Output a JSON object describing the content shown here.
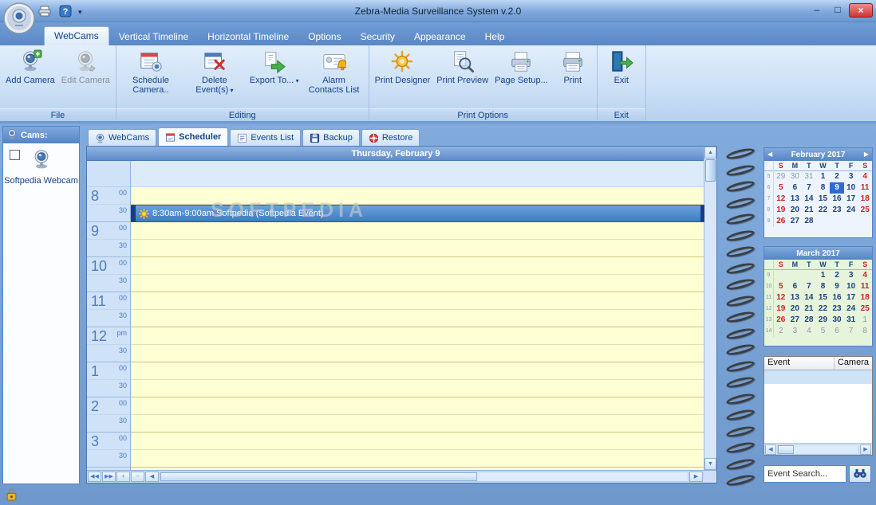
{
  "glyphs": {
    "dropdown": "▾",
    "minimize": "–",
    "maximize": "□",
    "close": "×",
    "up": "▲",
    "down": "▼",
    "left": "◀",
    "right": "▶",
    "first": "◀◀",
    "last": "▶▶",
    "plus": "+",
    "minus": "−",
    "cal_prev": "◀",
    "cal_next": "▶"
  },
  "titlebar": {
    "title": "Zebra-Media Surveillance System v.2.0"
  },
  "ribbon": {
    "tabs": [
      {
        "label": "WebCams",
        "active": true
      },
      {
        "label": "Vertical Timeline"
      },
      {
        "label": "Horizontal Timeline"
      },
      {
        "label": "Options"
      },
      {
        "label": "Security"
      },
      {
        "label": "Appearance"
      },
      {
        "label": "Help"
      }
    ],
    "groups": [
      {
        "label": "File",
        "buttons": [
          {
            "label": "Add Camera",
            "icon": "camera-add"
          },
          {
            "label": "Edit Camera",
            "icon": "camera-edit",
            "disabled": true
          }
        ]
      },
      {
        "label": "Editing",
        "buttons": [
          {
            "label": "Schedule Camera..",
            "icon": "schedule-camera"
          },
          {
            "label": "Delete Event(s)",
            "icon": "delete-event",
            "dropdown": true
          },
          {
            "label": "Export To...",
            "icon": "export",
            "dropdown": true
          },
          {
            "label": "Alarm Contacts List",
            "icon": "alarm-contacts"
          }
        ]
      },
      {
        "label": "Print Options",
        "buttons": [
          {
            "label": "Print Designer",
            "icon": "print-designer"
          },
          {
            "label": "Print Preview",
            "icon": "print-preview"
          },
          {
            "label": "Page Setup...",
            "icon": "page-setup"
          },
          {
            "label": "Print",
            "icon": "print"
          }
        ]
      },
      {
        "label": "Exit",
        "buttons": [
          {
            "label": "Exit",
            "icon": "exit"
          }
        ]
      }
    ]
  },
  "cams": {
    "header": "Cams:",
    "items": [
      {
        "label": "Softpedia Webcam",
        "checked": false
      }
    ]
  },
  "view_tabs": [
    {
      "label": "WebCams",
      "icon": "webcam-s"
    },
    {
      "label": "Scheduler",
      "icon": "scheduler-s",
      "active": true
    },
    {
      "label": "Events List",
      "icon": "events-s"
    },
    {
      "label": "Backup",
      "icon": "backup-s"
    },
    {
      "label": "Restore",
      "icon": "restore-s"
    }
  ],
  "scheduler": {
    "day_header": "Thursday, February 9",
    "watermark": "SOFTPEDIA",
    "hours": [
      {
        "h": "8",
        "m1": "00",
        "m2": "30"
      },
      {
        "h": "9",
        "m1": "00",
        "m2": "30"
      },
      {
        "h": "10",
        "m1": "00",
        "m2": "30"
      },
      {
        "h": "11",
        "m1": "00",
        "m2": "30"
      },
      {
        "h": "12",
        "m1": "pm",
        "m2": "30"
      },
      {
        "h": "1",
        "m1": "00",
        "m2": "30"
      },
      {
        "h": "2",
        "m1": "00",
        "m2": "30"
      },
      {
        "h": "3",
        "m1": "00",
        "m2": "30"
      }
    ],
    "event": {
      "slot": 1,
      "label": "8:30am-9:00am Softpedia (Softpedia Event)"
    }
  },
  "calendars": [
    {
      "title": "February 2017",
      "nav": true,
      "bg": "#edf4fe",
      "day_headers": [
        "S",
        "M",
        "T",
        "W",
        "T",
        "F",
        "S"
      ],
      "weeks": [
        {
          "n": "5",
          "d": [
            "29-",
            "30-",
            "31-",
            "1",
            "2",
            "3",
            "4"
          ]
        },
        {
          "n": "6",
          "d": [
            "5",
            "6",
            "7",
            "8",
            "9+",
            "10",
            "11"
          ]
        },
        {
          "n": "7",
          "d": [
            "12",
            "13",
            "14",
            "15",
            "16",
            "17",
            "18"
          ]
        },
        {
          "n": "8",
          "d": [
            "19",
            "20",
            "21",
            "22",
            "23",
            "24",
            "25"
          ]
        },
        {
          "n": "9",
          "d": [
            "26",
            "27",
            "28",
            "",
            "",
            "",
            ""
          ]
        }
      ]
    },
    {
      "title": "March 2017",
      "nav": false,
      "bg": "#e6f4db",
      "day_headers": [
        "S",
        "M",
        "T",
        "W",
        "T",
        "F",
        "S"
      ],
      "weeks": [
        {
          "n": "9",
          "d": [
            "",
            "",
            "",
            "1",
            "2",
            "3",
            "4"
          ]
        },
        {
          "n": "10",
          "d": [
            "5",
            "6",
            "7",
            "8",
            "9",
            "10",
            "11"
          ]
        },
        {
          "n": "11",
          "d": [
            "12",
            "13",
            "14",
            "15",
            "16",
            "17",
            "18"
          ]
        },
        {
          "n": "12",
          "d": [
            "19",
            "20",
            "21",
            "22",
            "23",
            "24",
            "25"
          ]
        },
        {
          "n": "13",
          "d": [
            "26",
            "27",
            "28",
            "29",
            "30",
            "31",
            "1-"
          ]
        },
        {
          "n": "14",
          "d": [
            "2-",
            "3-",
            "4-",
            "5-",
            "6-",
            "7-",
            "8-"
          ]
        }
      ]
    }
  ],
  "event_table": {
    "columns": [
      "Event",
      "Camera"
    ]
  },
  "search": {
    "value": "Event Search..."
  }
}
